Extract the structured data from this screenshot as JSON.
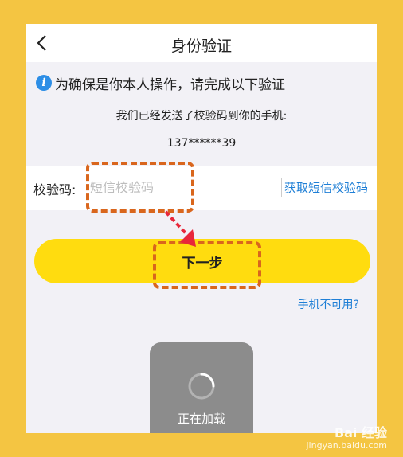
{
  "nav": {
    "title": "身份验证",
    "back_icon": "chevron-left-icon"
  },
  "notice": {
    "icon": "info-icon",
    "icon_glyph": "i",
    "text": "为确保是你本人操作，请完成以下验证"
  },
  "sent_message": "我们已经发送了校验码到你的手机:",
  "phone_number": "137******39",
  "code_field": {
    "label": "校验码:",
    "placeholder": "短信校验码",
    "value": "",
    "get_code_label": "获取短信校验码"
  },
  "next_button": {
    "label": "下一步"
  },
  "phone_unavailable_link": "手机不可用?",
  "loading_toast": {
    "text": "正在加载"
  },
  "watermark": {
    "brand": "Bai 经验",
    "url": "jingyan.baidu.com"
  },
  "colors": {
    "background": "#f4c542",
    "primary_button": "#ffdc0f",
    "link": "#1f7fd6",
    "annotation": "#d9661d",
    "arrow": "#e8273a"
  }
}
